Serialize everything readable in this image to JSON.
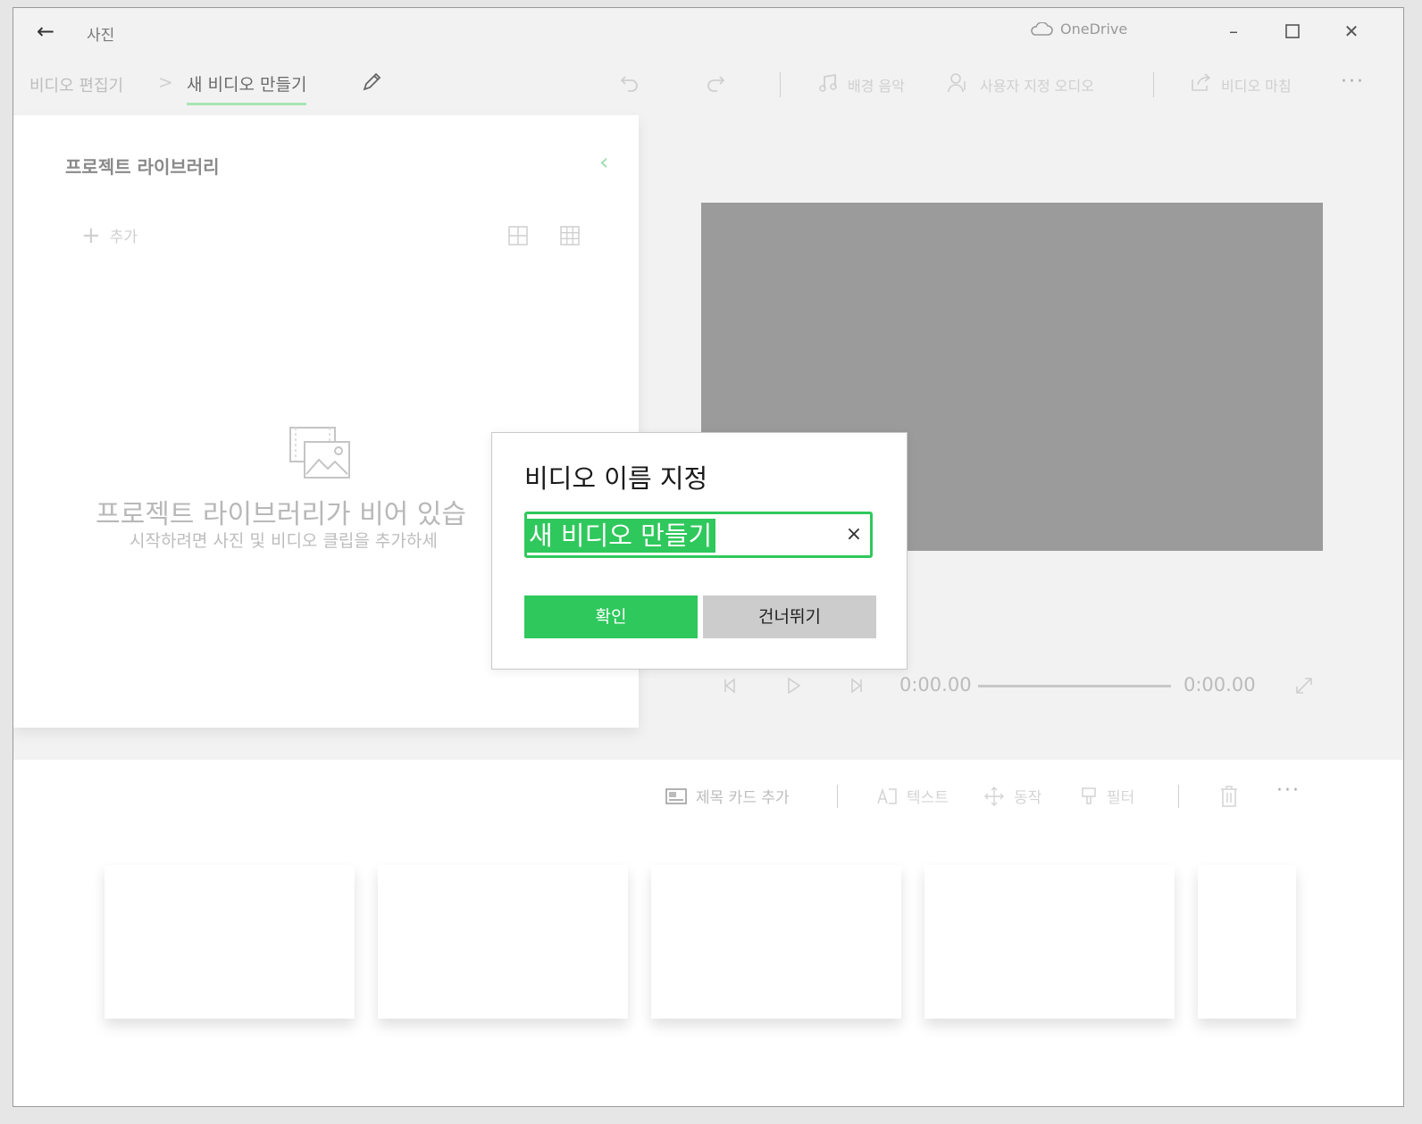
{
  "window": {
    "app_title": "사진",
    "onedrive_label": "OneDrive"
  },
  "breadcrumb": {
    "parent": "비디오 편집기",
    "separator": ">",
    "current": "새 비디오 만들기"
  },
  "toolbar": {
    "background_music": "배경 음악",
    "custom_audio": "사용자 지정 오디오",
    "finish_video": "비디오 마침",
    "more": "···"
  },
  "library": {
    "title": "프로젝트 라이브러리",
    "add_label": "추가",
    "empty_title": "프로젝트 라이브러리가 비어 있습",
    "empty_subtitle": "시작하려면 사진 및 비디오 클립을 추가하세"
  },
  "player": {
    "current_time": "0:00.00",
    "total_time": "0:00.00"
  },
  "storyboard": {
    "add_title_card": "제목 카드 추가",
    "text": "텍스트",
    "motion": "동작",
    "filters": "필터",
    "more": "···"
  },
  "dialog": {
    "title": "비디오 이름 지정",
    "input_value": "새 비디오 만들기",
    "clear_symbol": "×",
    "confirm_label": "확인",
    "skip_label": "건너뛰기"
  },
  "colors": {
    "accent": "#2fc85c",
    "preview_bg": "#9b9b9b"
  }
}
